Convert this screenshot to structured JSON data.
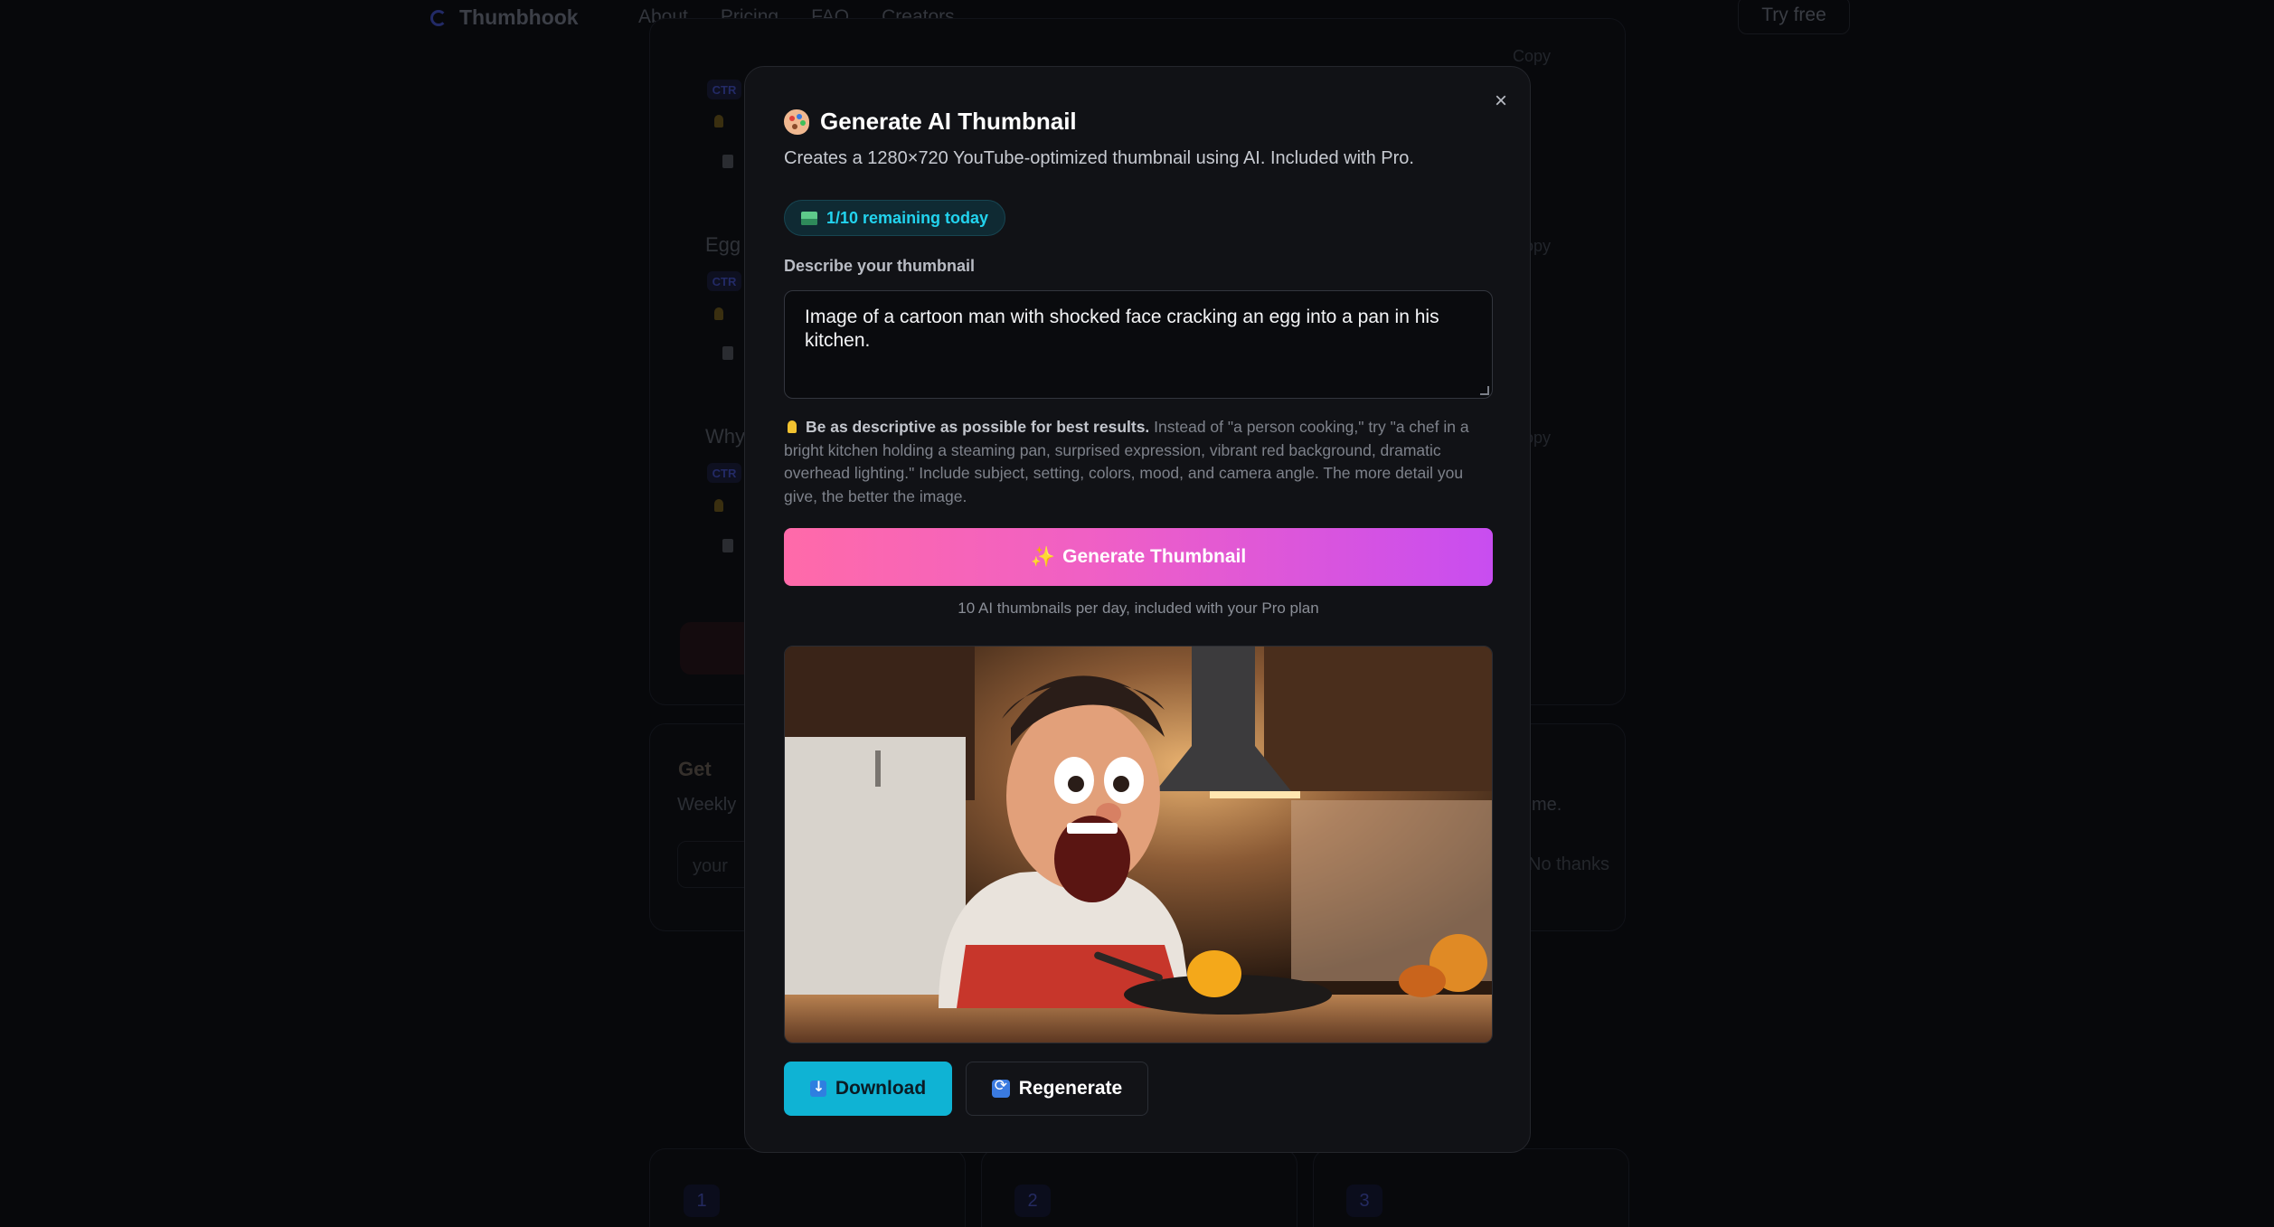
{
  "nav": {
    "brand": "Thumbhook",
    "links": [
      "About",
      "Pricing",
      "FAQ",
      "Creators"
    ],
    "cta": "Try free"
  },
  "background": {
    "sections": [
      "Egg",
      "Why"
    ],
    "pill": "CTR",
    "copy_label": "Copy",
    "newsletter_title": "Get",
    "newsletter_sub": "Weekly",
    "newsletter_placeholder": "your",
    "newsletter_right": "me.",
    "newsletter_no": "No thanks",
    "steps": [
      "1",
      "2",
      "3"
    ]
  },
  "modal": {
    "title": "Generate AI Thumbnail",
    "subtitle": "Creates a 1280×720 YouTube-optimized thumbnail using AI. Included with Pro.",
    "quota": "1/10 remaining today",
    "field_label": "Describe your thumbnail",
    "prompt_value": "Image of a cartoon man with shocked face cracking an egg into a pan in his kitchen.",
    "tip_bold": "Be as descriptive as possible for best results.",
    "tip_text": " Instead of \"a person cooking,\" try \"a chef in a bright kitchen holding a steaming pan, surprised expression, vibrant red background, dramatic overhead lighting.\" Include subject, setting, colors, mood, and camera angle. The more detail you give, the better the image.",
    "generate_label": "Generate Thumbnail",
    "generate_note": "10 AI thumbnails per day, included with your Pro plan",
    "download_label": "Download",
    "regenerate_label": "Regenerate",
    "close_symbol": "×"
  },
  "colors": {
    "accent_cyan": "#22d3ee",
    "download_bg": "#0fb3d4",
    "gradient_start": "#ff6aa9",
    "gradient_end": "#c84df0"
  }
}
